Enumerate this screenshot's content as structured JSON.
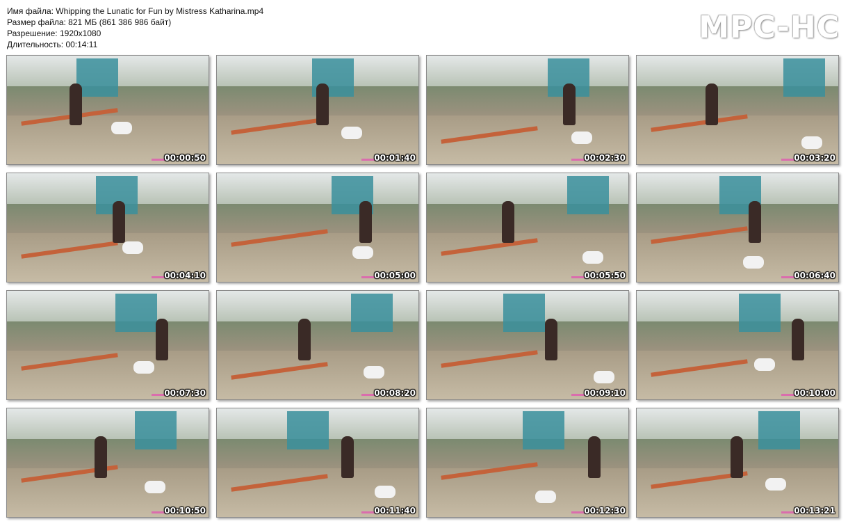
{
  "header": {
    "filename_line": "Имя файла: Whipping the Lunatic for Fun by Mistress Katharina.mp4",
    "filesize_line": "Размер файла: 821 МБ (861 386 986 байт)",
    "resolution_line": "Разрешение: 1920x1080",
    "duration_line": "Длительность: 00:14:11"
  },
  "logo": "MPC-HC",
  "thumbnails": [
    {
      "time": "00:00:50"
    },
    {
      "time": "00:01:40"
    },
    {
      "time": "00:02:30"
    },
    {
      "time": "00:03:20"
    },
    {
      "time": "00:04:10"
    },
    {
      "time": "00:05:00"
    },
    {
      "time": "00:05:50"
    },
    {
      "time": "00:06:40"
    },
    {
      "time": "00:07:30"
    },
    {
      "time": "00:08:20"
    },
    {
      "time": "00:09:10"
    },
    {
      "time": "00:10:00"
    },
    {
      "time": "00:10:50"
    },
    {
      "time": "00:11:40"
    },
    {
      "time": "00:12:30"
    },
    {
      "time": "00:13:21"
    }
  ]
}
